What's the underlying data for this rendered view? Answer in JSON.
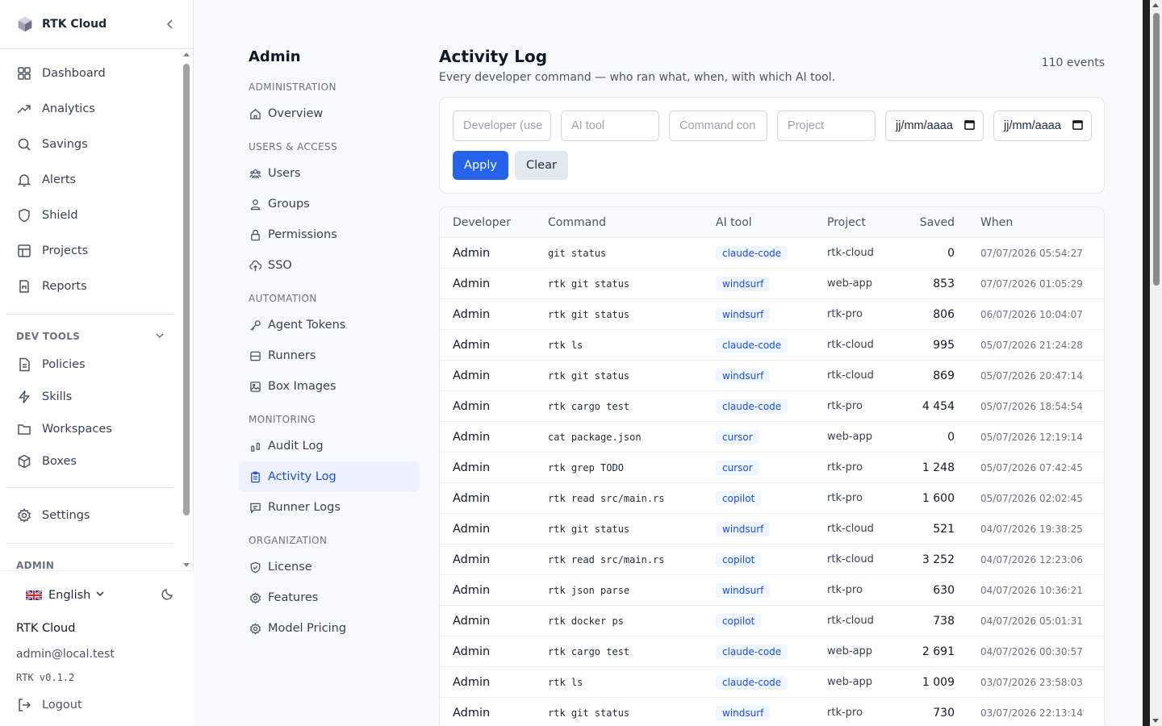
{
  "brand": {
    "name": "RTK Cloud"
  },
  "sidebar": {
    "items": [
      {
        "label": "Dashboard",
        "icon": "dashboard-icon"
      },
      {
        "label": "Analytics",
        "icon": "trending-up-icon"
      },
      {
        "label": "Savings",
        "icon": "search-icon"
      },
      {
        "label": "Alerts",
        "icon": "bell-icon"
      },
      {
        "label": "Shield",
        "icon": "shield-icon"
      },
      {
        "label": "Projects",
        "icon": "table-icon"
      },
      {
        "label": "Reports",
        "icon": "report-icon"
      }
    ],
    "dev_tools_label": "DEV TOOLS",
    "dev_tools": [
      {
        "label": "Policies",
        "icon": "file-icon"
      },
      {
        "label": "Skills",
        "icon": "lightning-icon"
      },
      {
        "label": "Workspaces",
        "icon": "folder-icon"
      },
      {
        "label": "Boxes",
        "icon": "box-icon"
      }
    ],
    "settings_label": "Settings",
    "admin_label": "ADMIN"
  },
  "footer": {
    "language": "English",
    "org_name": "RTK Cloud",
    "email": "admin@local.test",
    "version": "RTK v0.1.2",
    "logout": "Logout"
  },
  "subnav": {
    "title": "Admin",
    "sections": [
      {
        "label": "ADMINISTRATION",
        "items": [
          {
            "label": "Overview",
            "icon": "home-icon"
          }
        ]
      },
      {
        "label": "USERS & ACCESS",
        "items": [
          {
            "label": "Users",
            "icon": "users-icon"
          },
          {
            "label": "Groups",
            "icon": "group-icon"
          },
          {
            "label": "Permissions",
            "icon": "lock-icon"
          },
          {
            "label": "SSO",
            "icon": "cloud-icon"
          }
        ]
      },
      {
        "label": "AUTOMATION",
        "items": [
          {
            "label": "Agent Tokens",
            "icon": "key-icon"
          },
          {
            "label": "Runners",
            "icon": "server-icon"
          },
          {
            "label": "Box Images",
            "icon": "image-icon"
          }
        ]
      },
      {
        "label": "MONITORING",
        "items": [
          {
            "label": "Audit Log",
            "icon": "footprint-icon"
          },
          {
            "label": "Activity Log",
            "icon": "clipboard-icon",
            "active": true
          },
          {
            "label": "Runner Logs",
            "icon": "message-icon"
          }
        ]
      },
      {
        "label": "ORGANIZATION",
        "items": [
          {
            "label": "License",
            "icon": "shield-check-icon"
          },
          {
            "label": "Features",
            "icon": "gear-icon"
          },
          {
            "label": "Model Pricing",
            "icon": "gear-icon"
          }
        ]
      }
    ]
  },
  "main": {
    "title": "Activity Log",
    "subtitle": "Every developer command — who ran what, when, with which AI tool.",
    "event_count": "110 events",
    "filters": {
      "developer_placeholder": "Developer (use",
      "ai_tool_placeholder": "AI tool",
      "command_placeholder": "Command con",
      "project_placeholder": "Project",
      "date_from": "jj/mm/aaaa",
      "date_to": "jj/mm/aaaa"
    },
    "apply": "Apply",
    "clear": "Clear",
    "columns": [
      "Developer",
      "Command",
      "AI tool",
      "Project",
      "Saved",
      "When"
    ],
    "rows": [
      {
        "developer": "Admin",
        "command": "git status",
        "tool": "claude-code",
        "project": "rtk-cloud",
        "saved": "0",
        "when": "07/07/2026 05:54:27"
      },
      {
        "developer": "Admin",
        "command": "rtk git status",
        "tool": "windsurf",
        "project": "web-app",
        "saved": "853",
        "when": "07/07/2026 01:05:29"
      },
      {
        "developer": "Admin",
        "command": "rtk git status",
        "tool": "windsurf",
        "project": "rtk-pro",
        "saved": "806",
        "when": "06/07/2026 10:04:07"
      },
      {
        "developer": "Admin",
        "command": "rtk ls",
        "tool": "claude-code",
        "project": "rtk-cloud",
        "saved": "995",
        "when": "05/07/2026 21:24:28"
      },
      {
        "developer": "Admin",
        "command": "rtk git status",
        "tool": "windsurf",
        "project": "rtk-cloud",
        "saved": "869",
        "when": "05/07/2026 20:47:14"
      },
      {
        "developer": "Admin",
        "command": "rtk cargo test",
        "tool": "claude-code",
        "project": "rtk-pro",
        "saved": "4 454",
        "when": "05/07/2026 18:54:54"
      },
      {
        "developer": "Admin",
        "command": "cat package.json",
        "tool": "cursor",
        "project": "web-app",
        "saved": "0",
        "when": "05/07/2026 12:19:14"
      },
      {
        "developer": "Admin",
        "command": "rtk grep TODO",
        "tool": "cursor",
        "project": "rtk-pro",
        "saved": "1 248",
        "when": "05/07/2026 07:42:45"
      },
      {
        "developer": "Admin",
        "command": "rtk read src/main.rs",
        "tool": "copilot",
        "project": "rtk-pro",
        "saved": "1 600",
        "when": "05/07/2026 02:02:45"
      },
      {
        "developer": "Admin",
        "command": "rtk git status",
        "tool": "windsurf",
        "project": "rtk-cloud",
        "saved": "521",
        "when": "04/07/2026 19:38:25"
      },
      {
        "developer": "Admin",
        "command": "rtk read src/main.rs",
        "tool": "copilot",
        "project": "rtk-cloud",
        "saved": "3 252",
        "when": "04/07/2026 12:23:06"
      },
      {
        "developer": "Admin",
        "command": "rtk json parse",
        "tool": "windsurf",
        "project": "rtk-pro",
        "saved": "630",
        "when": "04/07/2026 10:36:21"
      },
      {
        "developer": "Admin",
        "command": "rtk docker ps",
        "tool": "copilot",
        "project": "rtk-cloud",
        "saved": "738",
        "when": "04/07/2026 05:01:31"
      },
      {
        "developer": "Admin",
        "command": "rtk cargo test",
        "tool": "claude-code",
        "project": "web-app",
        "saved": "2 691",
        "when": "04/07/2026 00:30:57"
      },
      {
        "developer": "Admin",
        "command": "rtk ls",
        "tool": "claude-code",
        "project": "web-app",
        "saved": "1 009",
        "when": "03/07/2026 23:58:03"
      },
      {
        "developer": "Admin",
        "command": "rtk git status",
        "tool": "windsurf",
        "project": "rtk-pro",
        "saved": "730",
        "when": "03/07/2026 22:13:14"
      }
    ]
  },
  "colors": {
    "accent": "#2563eb",
    "active_bg": "#eef2ff",
    "pill_bg": "#eff6ff",
    "pill_text": "#1d4ed8"
  }
}
